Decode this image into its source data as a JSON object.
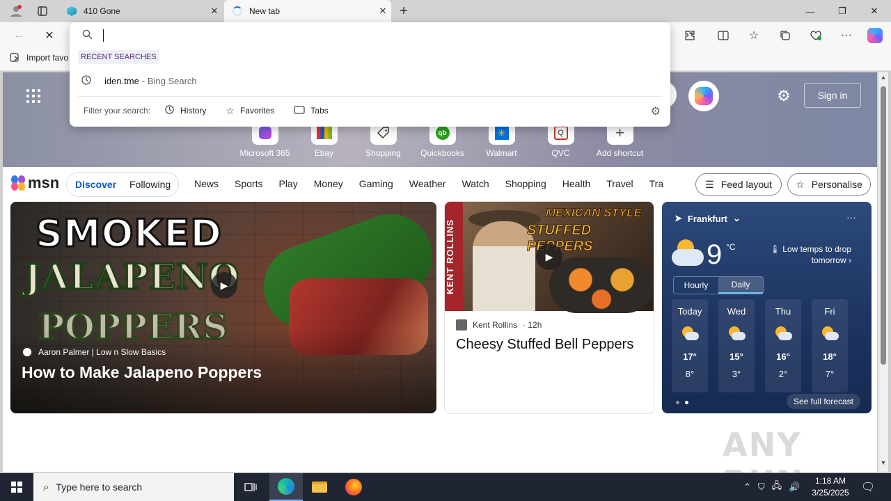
{
  "tabs": [
    {
      "label": "410 Gone"
    },
    {
      "label": "New tab"
    }
  ],
  "favorites_bar": {
    "import_label": "Import favo"
  },
  "omnibox": {
    "value": "",
    "recent_label": "RECENT SEARCHES",
    "suggestion": {
      "text": "iden.tme",
      "source": "- Bing Search"
    },
    "filter_label": "Filter your search:",
    "filters": [
      "History",
      "Favorites",
      "Tabs"
    ]
  },
  "newtab": {
    "sign_in": "Sign in",
    "shortcuts": [
      {
        "label": "Microsoft 365",
        "icon": "microsoft-365-icon"
      },
      {
        "label": "Ebay",
        "icon": "ebay-icon"
      },
      {
        "label": "Shopping",
        "icon": "shopping-tag-icon"
      },
      {
        "label": "Quickbooks",
        "icon": "quickbooks-icon"
      },
      {
        "label": "Walmart",
        "icon": "walmart-icon"
      },
      {
        "label": "QVC",
        "icon": "qvc-icon"
      },
      {
        "label": "Add shortcut",
        "icon": "plus-icon"
      }
    ]
  },
  "msn": {
    "logo": "msn",
    "discover": "Discover",
    "following": "Following",
    "categories": [
      "News",
      "Sports",
      "Play",
      "Money",
      "Gaming",
      "Weather",
      "Watch",
      "Shopping",
      "Health",
      "Travel",
      "Tra"
    ],
    "feed_layout": "Feed layout",
    "personalise": "Personalise"
  },
  "cards": {
    "main": {
      "overlay_line1": "SMOKED",
      "overlay_line2": "JALAPENO",
      "overlay_line3": "POPPERS",
      "source": "Aaron Palmer | Low n Slow Basics",
      "title": "How to Make Jalapeno Poppers"
    },
    "second": {
      "strip_text": "KENT ROLLINS",
      "overlay_line1": "MEXICAN STYLE",
      "overlay_line2": "STUFFED PEPPERS",
      "source": "Kent Rollins",
      "age": "· 12h",
      "title": "Cheesy Stuffed Bell Peppers"
    }
  },
  "weather": {
    "location": "Frankfurt",
    "temp": "9",
    "unit": "°C",
    "alert": "Low temps to drop tomorrow",
    "tabs": [
      "Hourly",
      "Daily"
    ],
    "days": [
      {
        "day": "Today",
        "hi": "17°",
        "lo": "8°"
      },
      {
        "day": "Wed",
        "hi": "15°",
        "lo": "3°"
      },
      {
        "day": "Thu",
        "hi": "16°",
        "lo": "2°"
      },
      {
        "day": "Fri",
        "hi": "18°",
        "lo": "7°"
      }
    ],
    "forecast_link": "See full forecast"
  },
  "watermark": "ANY RUN",
  "taskbar": {
    "search_placeholder": "Type here to search",
    "time": "1:18 AM",
    "date": "3/25/2025"
  }
}
